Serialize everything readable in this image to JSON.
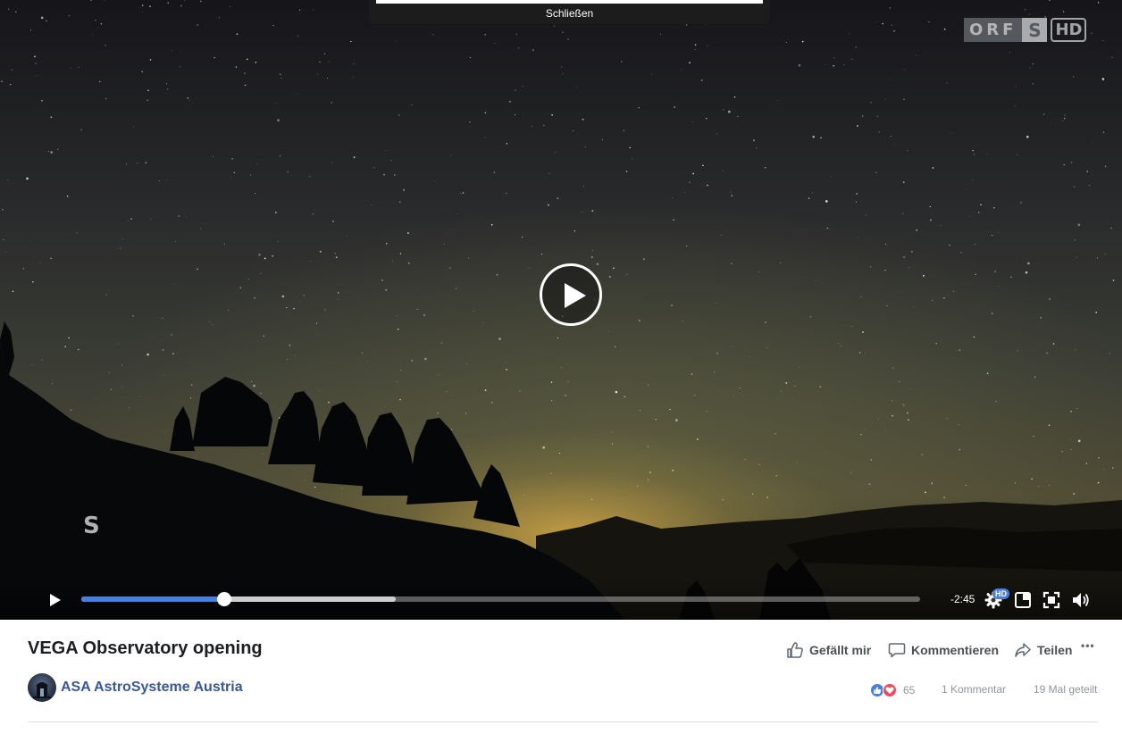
{
  "overlay": {
    "close_label": "Schließen"
  },
  "broadcaster_logo": {
    "text": "ORF",
    "s": "S",
    "hd": "HD"
  },
  "watermark": {
    "text": "S"
  },
  "player": {
    "time_remaining": "-2:45",
    "progress_played": 0.17,
    "progress_buffered": 0.375,
    "hd_badge": "HD",
    "accent_color": "#4a7fe0"
  },
  "icons": {
    "big_play": "play-circle-icon",
    "play": "play-icon",
    "settings": "gear-icon",
    "pip": "picture-in-picture-icon",
    "fullscreen": "fullscreen-icon",
    "volume": "volume-icon",
    "like": "thumbs-up-icon",
    "comment": "comment-icon",
    "share": "share-icon",
    "more": "more-icon"
  },
  "video": {
    "title": "VEGA Observatory opening"
  },
  "actions": {
    "like_label": "Gefällt mir",
    "comment_label": "Kommentieren",
    "share_label": "Teilen",
    "more_label": "•••"
  },
  "page": {
    "name": "ASA AstroSysteme Austria"
  },
  "stats": {
    "reaction_count": "65",
    "comment_count": "1 Kommentar",
    "share_count": "19 Mal geteilt",
    "like_color": "#4a7fe0",
    "love_color": "#f0485c"
  }
}
